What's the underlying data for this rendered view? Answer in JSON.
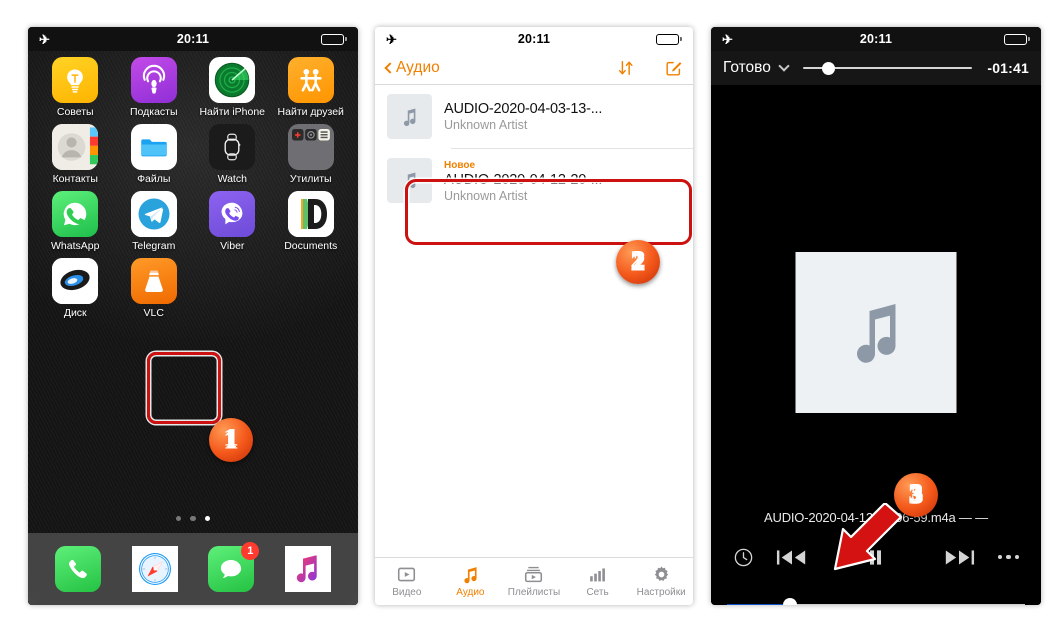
{
  "meta": {
    "accent_orange": "#f08000",
    "highlight_red": "#cc1111",
    "slider_blue": "#1050c8"
  },
  "phone1": {
    "status": {
      "airplane_icon": "airplane-mode-icon",
      "time": "20:11",
      "battery_icon": "battery-icon"
    },
    "apps": [
      {
        "label": "Советы",
        "icon": "tips-icon"
      },
      {
        "label": "Подкасты",
        "icon": "podcasts-icon"
      },
      {
        "label": "Найти iPhone",
        "icon": "find-my-iphone-icon"
      },
      {
        "label": "Найти друзей",
        "icon": "find-my-friends-icon"
      },
      {
        "label": "Контакты",
        "icon": "contacts-icon"
      },
      {
        "label": "Файлы",
        "icon": "files-icon"
      },
      {
        "label": "Watch",
        "icon": "watch-icon"
      },
      {
        "label": "Утилиты",
        "icon": "utilities-folder-icon"
      },
      {
        "label": "WhatsApp",
        "icon": "whatsapp-icon"
      },
      {
        "label": "Telegram",
        "icon": "telegram-icon"
      },
      {
        "label": "Viber",
        "icon": "viber-icon"
      },
      {
        "label": "Documents",
        "icon": "documents-icon"
      },
      {
        "label": "Диск",
        "icon": "yandex-disk-icon"
      },
      {
        "label": "VLC",
        "icon": "vlc-icon"
      }
    ],
    "page_dots": {
      "count": 3,
      "active_index": 2
    },
    "dock": [
      {
        "label": "Телефон",
        "icon": "phone-icon",
        "badge": ""
      },
      {
        "label": "Safari",
        "icon": "safari-icon",
        "badge": ""
      },
      {
        "label": "Сообщения",
        "icon": "messages-icon",
        "badge": "1"
      },
      {
        "label": "Музыка",
        "icon": "music-icon",
        "badge": ""
      }
    ],
    "step_marker": "1"
  },
  "phone2": {
    "status": {
      "time": "20:11"
    },
    "navbar": {
      "back_label": "Аудио",
      "sort_icon": "sort-arrows-icon",
      "compose_icon": "compose-edit-icon"
    },
    "rows": [
      {
        "new_badge": "",
        "title": "AUDIO-2020-04-03-13-...",
        "artist": "Unknown Artist",
        "icon": "music-note-icon",
        "highlighted": false
      },
      {
        "new_badge": "Новое",
        "title": "AUDIO-2020-04-12-20-...",
        "artist": "Unknown Artist",
        "icon": "music-note-icon",
        "highlighted": true
      }
    ],
    "tabs": [
      {
        "label": "Видео",
        "icon": "video-icon",
        "active": false
      },
      {
        "label": "Аудио",
        "icon": "audio-note-icon",
        "active": true
      },
      {
        "label": "Плейлисты",
        "icon": "playlists-icon",
        "active": false
      },
      {
        "label": "Сеть",
        "icon": "network-bars-icon",
        "active": false
      },
      {
        "label": "Настройки",
        "icon": "settings-gear-icon",
        "active": false
      }
    ],
    "step_marker": "2"
  },
  "phone3": {
    "status": {
      "time": "20:11"
    },
    "topbar": {
      "done_label": "Готово",
      "chevron_icon": "chevron-down-icon",
      "remaining_time": "-01:41",
      "position_percent": 11
    },
    "artwork_icon": "music-note-artwork-icon",
    "file_title": "AUDIO-2020-04-12-20-06-59.m4a — —",
    "controls": {
      "sleep_timer_icon": "clock-icon",
      "previous_icon": "skip-backward-icon",
      "pause_icon": "pause-icon",
      "next_icon": "skip-forward-icon",
      "more_icon": "more-options-icon"
    },
    "seek_bar": {
      "progress_percent": 21
    },
    "step_marker": "3"
  }
}
